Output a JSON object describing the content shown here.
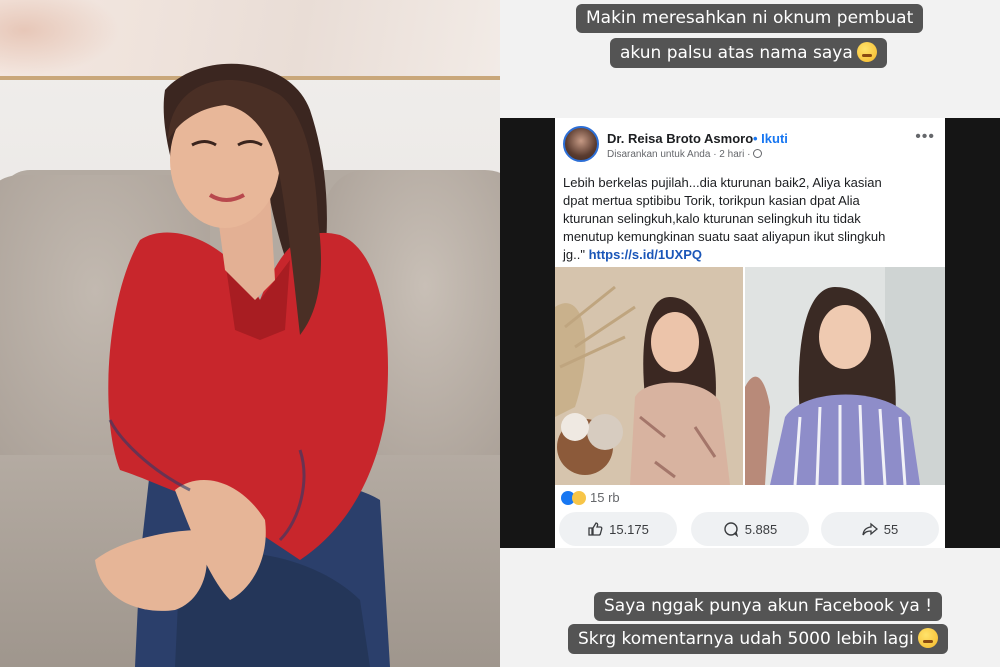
{
  "story": {
    "top_caption_line1": "Makin meresahkan ni oknum pembuat",
    "top_caption_line2": "akun palsu atas nama saya",
    "bottom_caption_line1": "Saya nggak punya akun Facebook ya !",
    "bottom_caption_line2": "Skrg komentarnya udah 5000 lebih lagi"
  },
  "facebook_post": {
    "author": "Dr. Reisa Broto Asmoro",
    "follow_label": "• Ikuti",
    "suggested": "Disarankan untuk Anda",
    "time": "· 2 hari ·",
    "more_label": "•••",
    "body_line1": "Lebih berkelas pujilah...dia kturunan baik2, Aliya kasian",
    "body_line2": "dpat mertua sptibibu Torik, torikpun kasian dpat Alia",
    "body_line3": "kturunan selingkuh,kalo kturunan selingkuh itu tidak",
    "body_line4": "menutup kemungkinan suatu saat aliyapun ikut slingkuh",
    "body_line5_prefix": "jg..\" ",
    "link": "https://s.id/1UXPQ",
    "reaction_count": "15 rb",
    "likes": "15.175",
    "comments": "5.885",
    "shares": "55"
  },
  "icons": [
    "like-icon",
    "comment-icon",
    "share-icon",
    "globe-icon",
    "more-icon"
  ],
  "colors": {
    "facebook_blue": "#1877f2",
    "link_blue": "#1a56b8",
    "caption_bg": "#464646"
  }
}
